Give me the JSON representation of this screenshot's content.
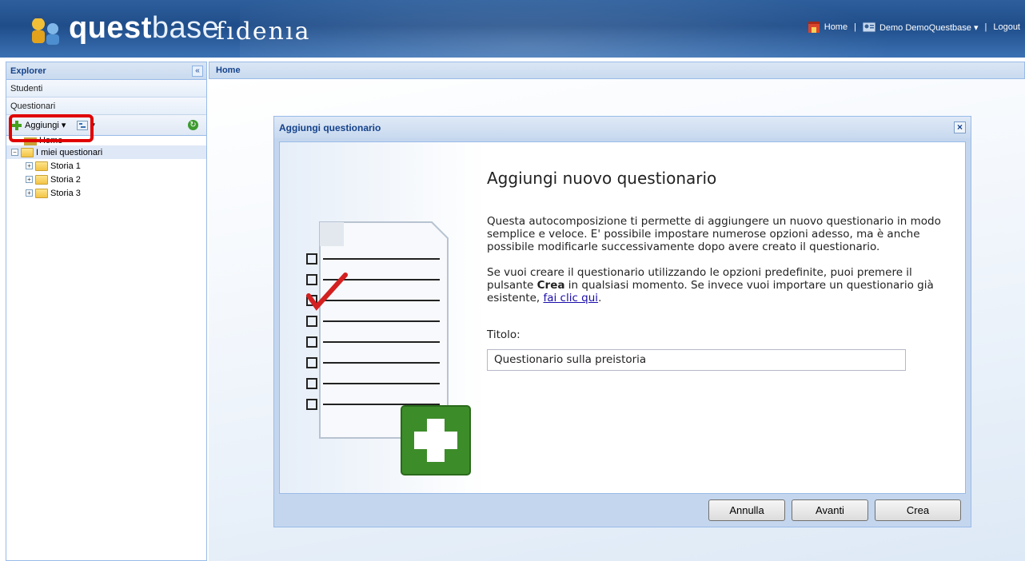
{
  "header": {
    "brand_bold": "quest",
    "brand_light": "base",
    "brand_partner": "fıdenıa",
    "home_link": "Home",
    "user_link": "Demo DemoQuestbase",
    "separator": "|",
    "logout_link": "Logout"
  },
  "sidebar": {
    "title": "Explorer",
    "collapse_glyph": "«",
    "sections": [
      "Studenti",
      "Questionari"
    ],
    "toolbar": {
      "add_label": "Aggiungi ▾",
      "view_glyph": "▾"
    },
    "tree": {
      "home": "Home",
      "root": "I miei questionari",
      "folders": [
        "Storia 1",
        "Storia 2",
        "Storia 3"
      ]
    }
  },
  "main": {
    "tab_title": "Home"
  },
  "dialog": {
    "title": "Aggiungi questionario",
    "heading": "Aggiungi nuovo questionario",
    "paragraph1": "Questa autocomposizione ti permette di aggiungere un nuovo questionario in modo semplice e veloce. E' possibile impostare numerose opzioni adesso, ma è anche possibile modificarle successivamente dopo avere creato il questionario.",
    "paragraph2_before": "Se vuoi creare il questionario utilizzando le opzioni predefinite, puoi premere il pulsante ",
    "paragraph2_bold": "Crea",
    "paragraph2_after": " in qualsiasi momento. Se invece vuoi importare un questionario già esistente, ",
    "paragraph2_link": "fai clic qui",
    "paragraph2_end": ".",
    "title_label": "Titolo:",
    "title_value": "Questionario sulla preistoria",
    "buttons": {
      "cancel": "Annulla",
      "next": "Avanti",
      "create": "Crea"
    }
  },
  "colors": {
    "accent": "#15428b",
    "highlight": "#e00000",
    "add_green": "#46a21e"
  }
}
